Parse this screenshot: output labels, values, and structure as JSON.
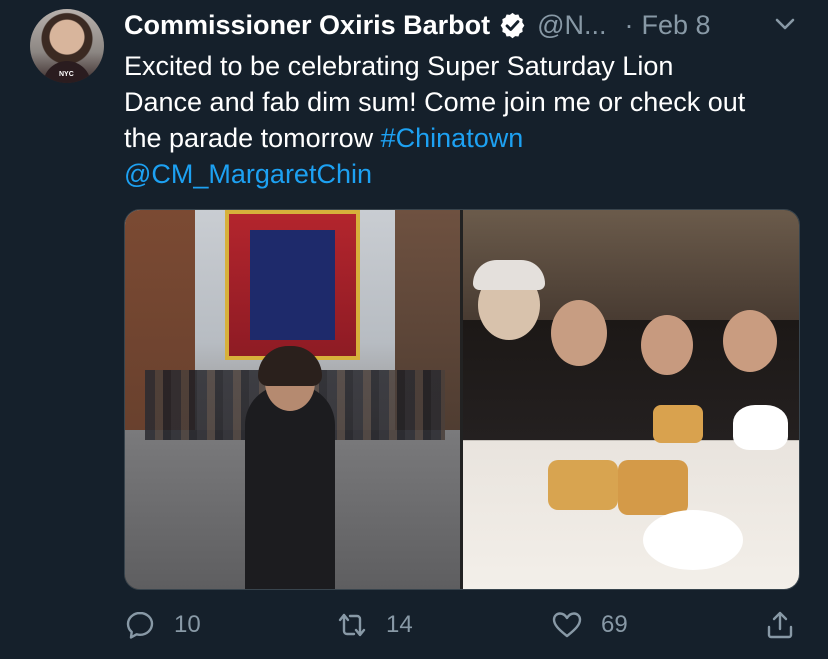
{
  "author": {
    "name": "Commissioner Oxiris Barbot",
    "handle": "@N...",
    "separator": "·",
    "date": "Feb 8",
    "avatar_badge": "NYC",
    "verified": true
  },
  "tweet": {
    "text_line1": "Excited to be celebrating Super Saturday Lion",
    "text_line2": "Dance and fab dim sum!  Come join me or check out",
    "text_line3": "the parade tomorrow ",
    "hashtag": "#Chinatown",
    "mention": "@CM_MargaretChin"
  },
  "actions": {
    "reply_count": "10",
    "retweet_count": "14",
    "like_count": "69"
  },
  "colors": {
    "background": "#15202b",
    "text": "#ffffff",
    "muted": "#8899a6",
    "link": "#1da1f2"
  },
  "icons": [
    "verified-badge-icon",
    "chevron-down-icon",
    "reply-icon",
    "retweet-icon",
    "like-icon",
    "share-icon"
  ]
}
